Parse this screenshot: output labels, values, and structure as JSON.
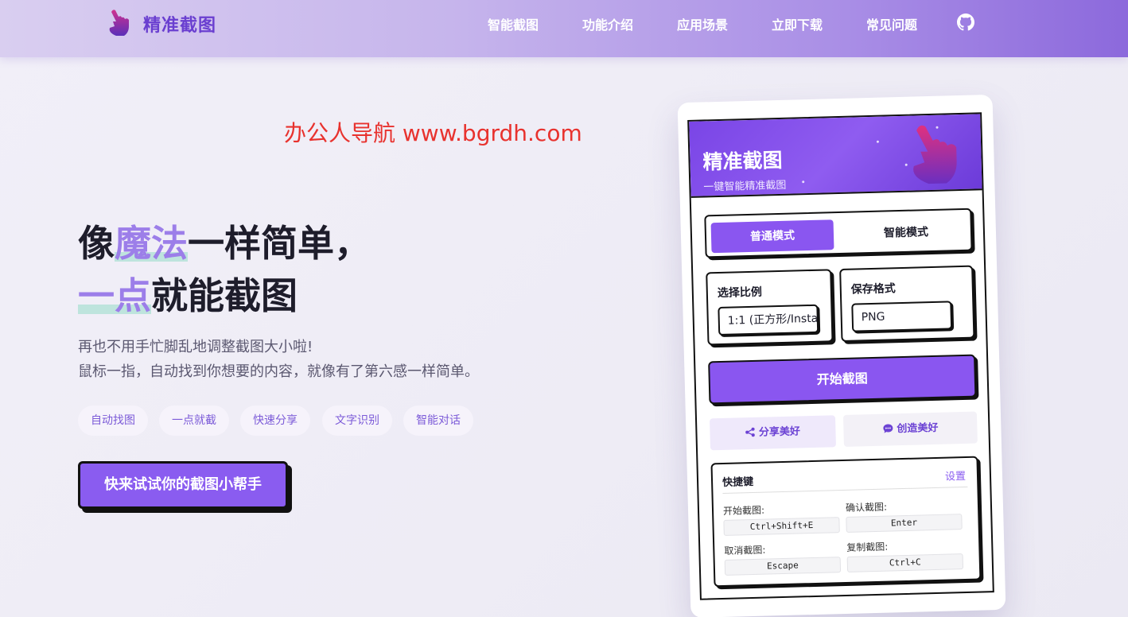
{
  "brand": {
    "name": "精准截图"
  },
  "nav": {
    "items": [
      "智能截图",
      "功能介绍",
      "应用场景",
      "立即下载",
      "常见问题"
    ]
  },
  "watermark": "办公人导航 www.bgrdh.com",
  "hero": {
    "line1_pre": "像",
    "line1_accent": "魔法",
    "line1_post": "一样简单，",
    "line2_accent": "一点",
    "line2_post": "就能截图",
    "desc1": "再也不用手忙脚乱地调整截图大小啦!",
    "desc2": "鼠标一指，自动找到你想要的内容，就像有了第六感一样简单。",
    "tags": [
      "自动找图",
      "一点就截",
      "快速分享",
      "文字识别",
      "智能对话"
    ],
    "cta": "快来试试你的截图小帮手"
  },
  "mock": {
    "title": "精准截图",
    "subtitle": "一键智能精准截图",
    "mode_active": "普通模式",
    "mode_other": "智能模式",
    "ratio_label": "选择比例",
    "ratio_value": "1:1 (正方形/Insta",
    "format_label": "保存格式",
    "format_value": "PNG",
    "start": "开始截图",
    "share": "分享美好",
    "create": "创造美好",
    "shortcuts_title": "快捷键",
    "shortcuts_settings": "设置",
    "shortcuts": [
      {
        "label": "开始截图:",
        "key": "Ctrl+Shift+E"
      },
      {
        "label": "确认截图:",
        "key": "Enter"
      },
      {
        "label": "取消截图:",
        "key": "Escape"
      },
      {
        "label": "复制截图:",
        "key": "Ctrl+C"
      }
    ]
  },
  "colors": {
    "accent": "#8a56f0",
    "brand_text": "#6a3fd0",
    "watermark": "#e8322e"
  }
}
